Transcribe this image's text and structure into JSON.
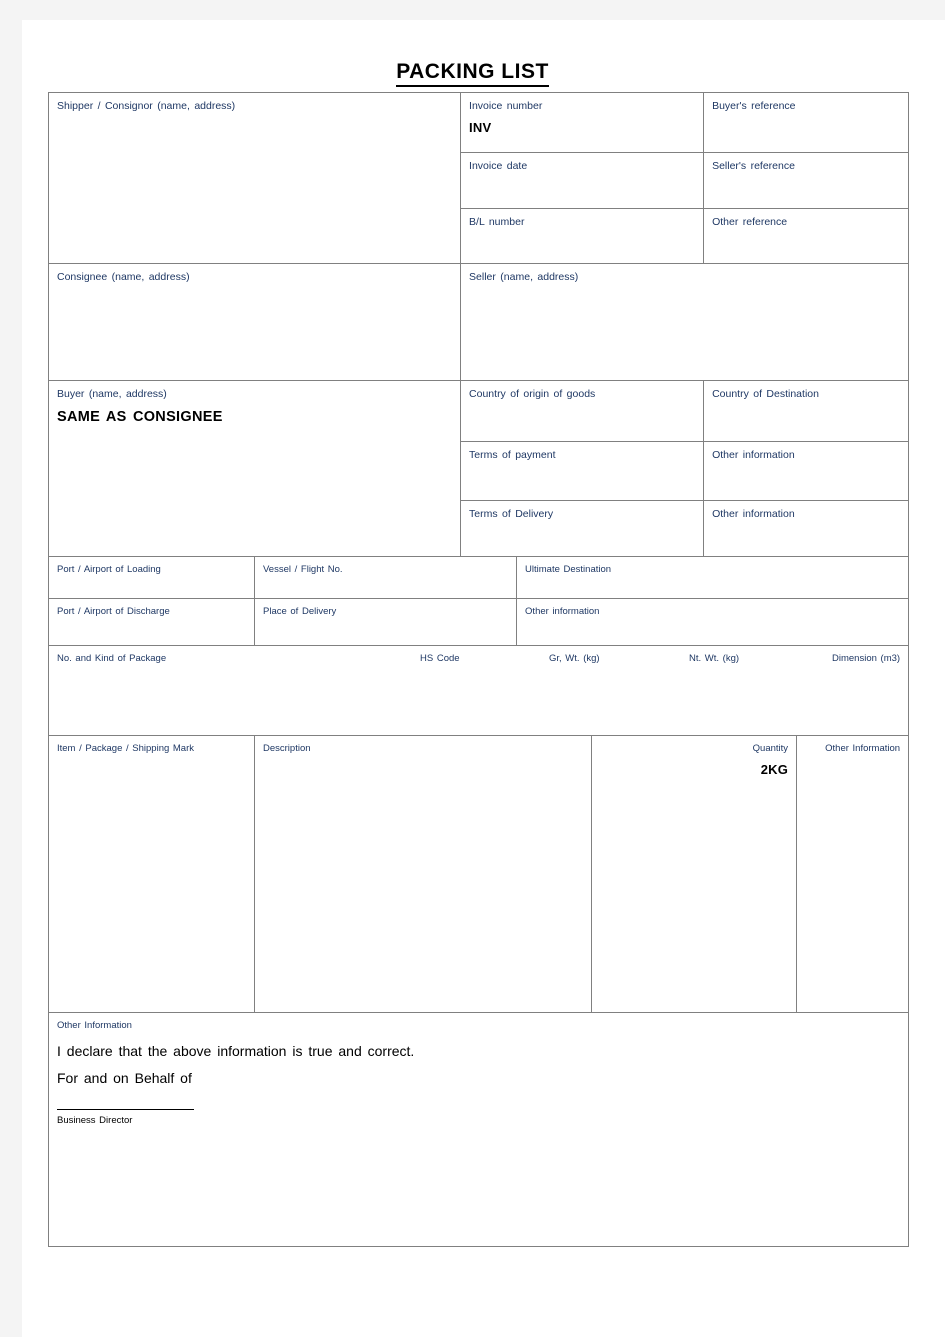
{
  "document": {
    "title": "PACKING LIST"
  },
  "parties": {
    "shipper_label": "Shipper / Consignor (name, address)",
    "shipper_value": "",
    "consignee_label": "Consignee (name, address)",
    "consignee_value": "",
    "seller_label": "Seller (name, address)",
    "seller_value": "",
    "buyer_label": "Buyer (name, address)",
    "buyer_value": "SAME AS CONSIGNEE"
  },
  "references": {
    "invoice_number_label": "Invoice number",
    "invoice_number_value": "INV",
    "buyers_reference_label": "Buyer's reference",
    "buyers_reference_value": "",
    "invoice_date_label": "Invoice date",
    "invoice_date_value": "",
    "sellers_reference_label": "Seller's reference",
    "sellers_reference_value": "",
    "bl_number_label": "B/L number",
    "bl_number_value": "",
    "other_reference_label": "Other reference",
    "other_reference_value": ""
  },
  "trade": {
    "country_of_origin_label": "Country of origin of goods",
    "country_of_origin_value": "",
    "country_of_destination_label": "Country of Destination",
    "country_of_destination_value": "",
    "terms_of_payment_label": "Terms of payment",
    "terms_of_payment_value": "",
    "other_information_1_label": "Other information",
    "other_information_1_value": "",
    "terms_of_delivery_label": "Terms of Delivery",
    "terms_of_delivery_value": "",
    "other_information_2_label": "Other information",
    "other_information_2_value": ""
  },
  "transport": {
    "port_of_loading_label": "Port / Airport of Loading",
    "port_of_loading_value": "",
    "vessel_flight_label": "Vessel / Flight No.",
    "vessel_flight_value": "",
    "ultimate_destination_label": "Ultimate Destination",
    "ultimate_destination_value": "",
    "port_of_discharge_label": "Port / Airport of Discharge",
    "port_of_discharge_value": "",
    "place_of_delivery_label": "Place of Delivery",
    "place_of_delivery_value": "",
    "other_information_label": "Other information",
    "other_information_value": ""
  },
  "package_summary": {
    "no_and_kind_label": "No. and Kind of Package",
    "hs_code_label": "HS Code",
    "gross_weight_label": "Gr, Wt. (kg)",
    "net_weight_label": "Nt. Wt. (kg)",
    "dimension_label": "Dimension (m3)",
    "no_and_kind_value": "",
    "hs_code_value": "",
    "gross_weight_value": "",
    "net_weight_value": "",
    "dimension_value": ""
  },
  "items_table": {
    "headers": {
      "item_package_mark": "Item / Package / Shipping Mark",
      "description": "Description",
      "quantity": "Quantity",
      "other_information": "Other Information"
    },
    "row": {
      "item_package_mark": "",
      "description": "",
      "quantity": "2KG",
      "other_information": ""
    }
  },
  "footer": {
    "other_information_label": "Other Information",
    "declaration_line_1": "I declare that the above information is true and correct.",
    "declaration_line_2": "For and on Behalf of",
    "signature_caption": "Business Director"
  },
  "colors": {
    "label_blue": "#1f3864",
    "border_gray": "#808080",
    "page_background": "#f4f4f4"
  }
}
